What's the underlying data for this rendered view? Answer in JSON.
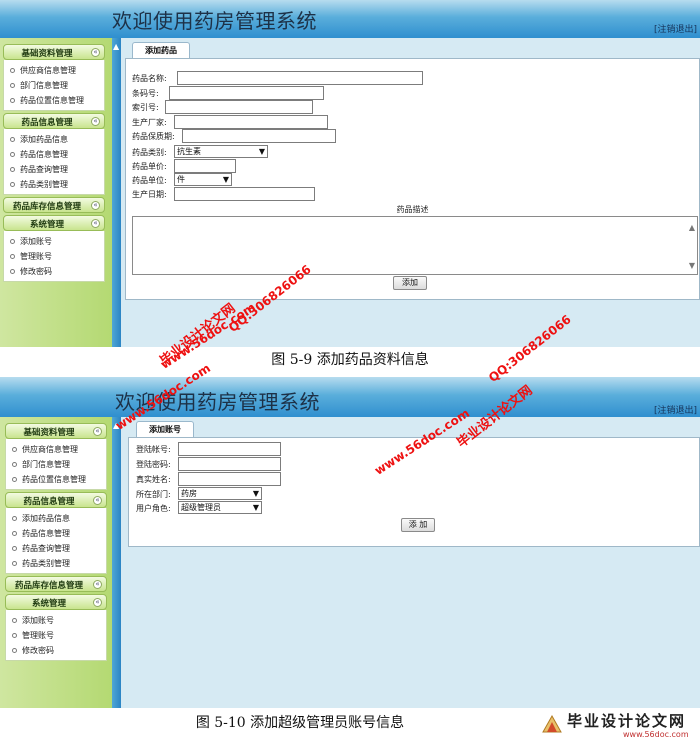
{
  "app_title": "欢迎使用药房管理系统",
  "logout_label": "[注销退出]",
  "sidebar": {
    "sections": [
      {
        "title": "基础资料管理",
        "items": [
          "供应商信息管理",
          "部门信息管理",
          "药品位置信息管理"
        ]
      },
      {
        "title": "药品信息管理",
        "items": [
          "添加药品信息",
          "药品信息管理",
          "药品查询管理",
          "药品类别管理"
        ]
      },
      {
        "title": "药品库存信息管理",
        "items": []
      },
      {
        "title": "系统管理",
        "items": [
          "添加账号",
          "管理账号",
          "修改密码"
        ]
      }
    ]
  },
  "screen1": {
    "tab_label": "添加药品",
    "fields": [
      {
        "label": "药品名称:",
        "value": ""
      },
      {
        "label": "条码号:",
        "value": ""
      },
      {
        "label": "索引号:",
        "value": ""
      },
      {
        "label": "生产厂家:",
        "value": ""
      },
      {
        "label": "药品保质期:",
        "value": ""
      },
      {
        "label": "药品类别:",
        "value": "抗生素"
      },
      {
        "label": "药品单价:",
        "value": ""
      },
      {
        "label": "药品单位:",
        "value": "件"
      },
      {
        "label": "生产日期:",
        "value": ""
      }
    ],
    "description_label": "药品描述",
    "submit_label": "添加"
  },
  "caption1": "图 5-9 添加药品资料信息",
  "screen2": {
    "tab_label": "添加账号",
    "fields": [
      {
        "label": "登陆帐号:",
        "value": ""
      },
      {
        "label": "登陆密码:",
        "value": ""
      },
      {
        "label": "真实姓名:",
        "value": ""
      },
      {
        "label": "所在部门:",
        "value": "药房"
      },
      {
        "label": "用户角色:",
        "value": "超级管理员"
      }
    ],
    "submit_label": "添 加"
  },
  "caption2": "图 5-10 添加超级管理员账号信息",
  "watermarks": {
    "site_cn": "毕业设计论文网",
    "site_url": "www.56doc.com",
    "qq": "QQ:306826066"
  },
  "logo": {
    "text": "毕业设计论文网",
    "url": "www.56doc.com"
  },
  "colors": {
    "banner": "#3a96d2",
    "sidebar": "#c2df88",
    "watermark": "#e11111"
  }
}
